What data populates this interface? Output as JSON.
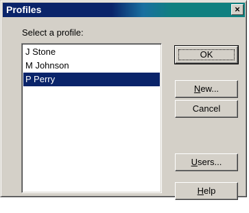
{
  "window": {
    "title": "Profiles",
    "close_glyph": "×"
  },
  "prompt": "Select a profile:",
  "profiles": [
    {
      "name": "J Stone",
      "selected": false
    },
    {
      "name": "M Johnson",
      "selected": false
    },
    {
      "name": "P Perry",
      "selected": true
    }
  ],
  "buttons": {
    "ok": "OK",
    "new": {
      "accel": "N",
      "rest": "ew..."
    },
    "cancel": "Cancel",
    "users": {
      "accel": "U",
      "rest": "sers..."
    },
    "help": {
      "accel": "H",
      "rest": "elp"
    }
  },
  "colors": {
    "selection": "#0a246a",
    "face": "#d4d0c8",
    "title_start": "#0a246a",
    "title_end": "#108080"
  }
}
